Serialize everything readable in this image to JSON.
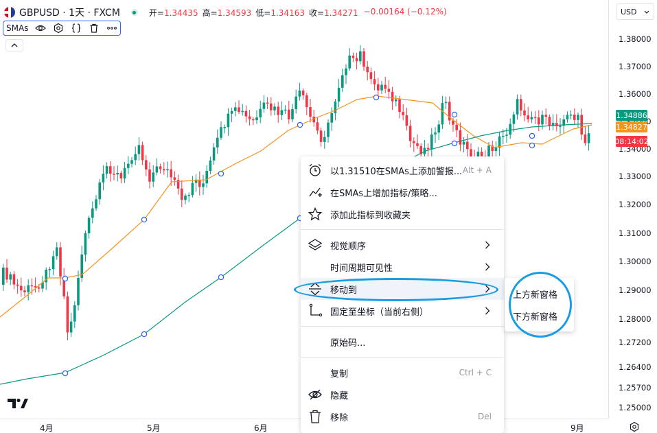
{
  "legend": {
    "symbol": "GBPUSD · 1天 · FXCM",
    "ohlc": [
      {
        "key": "开=",
        "value": "1.34435"
      },
      {
        "key": "高=",
        "value": "1.34593"
      },
      {
        "key": "低=",
        "value": "1.34163"
      },
      {
        "key": "收=",
        "value": "1.34271"
      }
    ],
    "change": "−0.00164 (−0.12%)"
  },
  "study": {
    "name": "SMAs"
  },
  "price_scale": {
    "currency": "USD",
    "ticks": [
      "1.38000",
      "1.37000",
      "1.36000",
      "1.35000",
      "1.34000",
      "1.33000",
      "1.32000",
      "1.31000",
      "1.30000",
      "1.29000",
      "1.28000",
      "1.27200",
      "1.26400",
      "1.25700",
      "1.25000"
    ],
    "tags": [
      {
        "text": "1.34886",
        "color": "#089981"
      },
      {
        "text": "1.34827",
        "color": "#f7931a"
      },
      {
        "text": "08:14:02",
        "color": "#f23645"
      }
    ]
  },
  "time_axis": {
    "labels": [
      "4月",
      "5月",
      "6月",
      "9月"
    ]
  },
  "context_menu": {
    "items": [
      {
        "label": "以1.31510在SMAs上添加警报...",
        "shortcut": "Alt + A"
      },
      {
        "label": "在SMAs上增加指标/策略..."
      },
      {
        "label": "添加此指标到收藏夹"
      },
      {
        "label": "视觉顺序"
      },
      {
        "label": "时间周期可见性"
      },
      {
        "label": "移动到"
      },
      {
        "label": "固定至坐标（当前右侧）"
      },
      {
        "label": "原始码..."
      },
      {
        "label": "复制",
        "shortcut": "Ctrl + C"
      },
      {
        "label": "隐藏"
      },
      {
        "label": "移除",
        "shortcut": "Del"
      }
    ]
  },
  "submenu": {
    "items": [
      "上方新窗格",
      "下方新窗格"
    ]
  },
  "colors": {
    "up": "#089981",
    "down": "#f23645",
    "sma_fast": "#f7931a",
    "sma_slow": "#089981",
    "highlight": "#1a9de0"
  }
}
